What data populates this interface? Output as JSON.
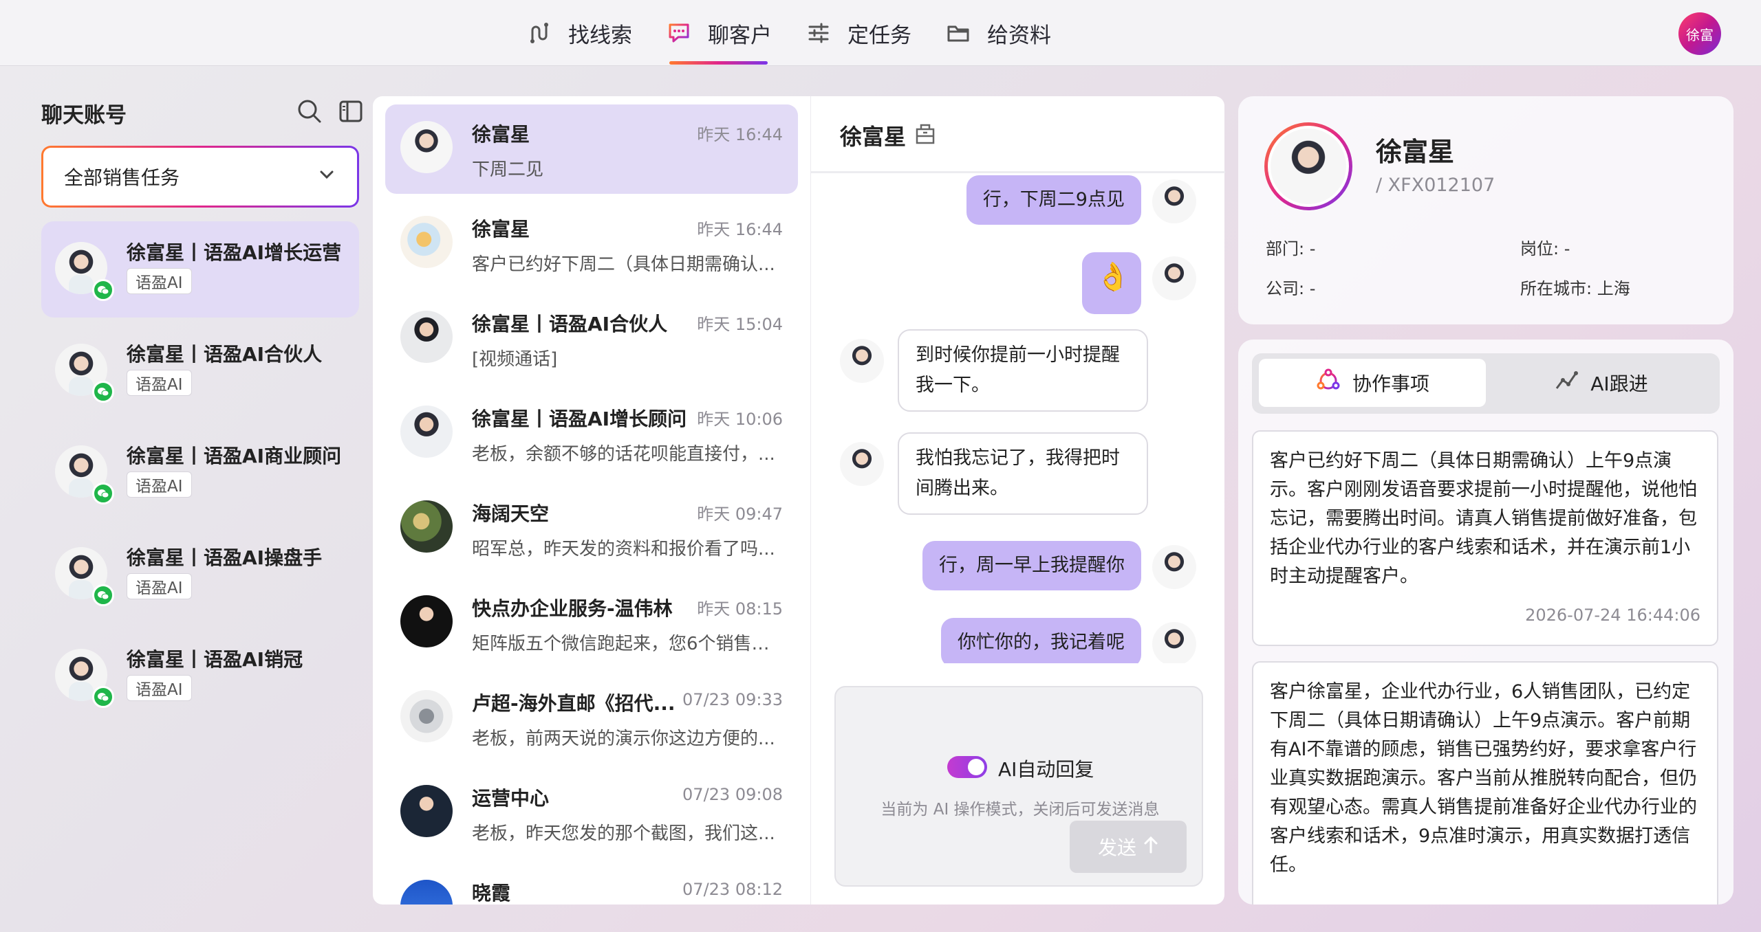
{
  "nav": {
    "items": [
      {
        "label": "找线索",
        "icon": "route-icon"
      },
      {
        "label": "聊客户",
        "icon": "chat-icon"
      },
      {
        "label": "定任务",
        "icon": "sliders-icon"
      },
      {
        "label": "给资料",
        "icon": "folder-icon"
      }
    ],
    "active_index": 1,
    "user_avatar_text": "徐富"
  },
  "left": {
    "title": "聊天账号",
    "task_filter": "全部销售任务",
    "accounts": [
      {
        "name": "徐富星丨语盈AI增长运营",
        "tag": "语盈AI",
        "active": true
      },
      {
        "name": "徐富星丨语盈AI合伙人",
        "tag": "语盈AI"
      },
      {
        "name": "徐富星丨语盈AI商业顾问",
        "tag": "语盈AI"
      },
      {
        "name": "徐富星丨语盈AI操盘手",
        "tag": "语盈AI"
      },
      {
        "name": "徐富星丨语盈AI销冠",
        "tag": "语盈AI"
      }
    ]
  },
  "conversations": [
    {
      "name": "徐富星",
      "time": "昨天 16:44",
      "msg": "下周二见",
      "active": true
    },
    {
      "name": "徐富星",
      "time": "昨天 16:44",
      "msg": "客户已约好下周二（具体日期需确认..."
    },
    {
      "name": "徐富星丨语盈AI合伙人",
      "time": "昨天 15:04",
      "msg": "[视频通话]"
    },
    {
      "name": "徐富星丨语盈AI增长顾问",
      "time": "昨天 10:06",
      "msg": "老板，余额不够的话花呗能直接付，..."
    },
    {
      "name": "海阔天空",
      "time": "昨天 09:47",
      "msg": "昭军总，昨天发的资料和报价看了吗..."
    },
    {
      "name": "快点办企业服务-温伟林",
      "time": "昨天 08:15",
      "msg": "矩阵版五个微信跑起来，您6个销售刚..."
    },
    {
      "name": "卢超-海外直邮《招代...",
      "time": "07/23 09:33",
      "msg": "老板，前两天说的演示你这边方便的..."
    },
    {
      "name": "运营中心",
      "time": "07/23 09:08",
      "msg": "老板，昨天您发的那个截图，我们这..."
    },
    {
      "name": "晓霞",
      "time": "07/23 08:12",
      "msg": ""
    }
  ],
  "chat": {
    "contact_name": "徐富星",
    "messages": [
      {
        "from": "me",
        "text": "行，下周二9点见"
      },
      {
        "from": "me",
        "text": "👌"
      },
      {
        "from": "them",
        "text": "到时候你提前一小时提醒我一下。"
      },
      {
        "from": "them",
        "text": "我怕我忘记了，我得把时间腾出来。"
      },
      {
        "from": "me",
        "text": "行，周一早上我提醒你"
      },
      {
        "from": "me",
        "text": "你忙你的，我记着呢"
      }
    ],
    "auto_reply_label": "AI自动回复",
    "auto_reply_on": true,
    "hint": "当前为 AI 操作模式，关闭后可发送消息",
    "send_label": "发送"
  },
  "profile": {
    "name": "徐富星",
    "id": "/ XFX012107",
    "dept": "部门: -",
    "position": "岗位: -",
    "company": "公司: -",
    "city": "所在城市: 上海"
  },
  "collab": {
    "tabs": [
      "协作事项",
      "AI跟进"
    ],
    "active_tab": 0,
    "notes": [
      {
        "text": "客户已约好下周二（具体日期需确认）上午9点演示。客户刚刚发语音要求提前一小时提醒他，说他怕忘记，需要腾出时间。请真人销售提前做好准备，包括企业代办行业的客户线索和话术，并在演示前1小时主动提醒客户。",
        "time": "2026-07-24 16:44:06"
      },
      {
        "text": "客户徐富星，企业代办行业，6人销售团队，已约定下周二（具体日期请确认）上午9点演示。客户前期有AI不靠谱的顾虑，销售已强势约好，要求拿客户行业真实数据跑演示。客户当前从推脱转向配合，但仍有观望心态。需真人销售提前准备好企业代办行业的客户线索和话术，9点准时演示，用真实数据打透信任。"
      }
    ]
  },
  "colors": {
    "accent_purple": "#c6b5f6",
    "active_bg": "#e2dbf6",
    "wechat_green": "#1fb64a"
  }
}
